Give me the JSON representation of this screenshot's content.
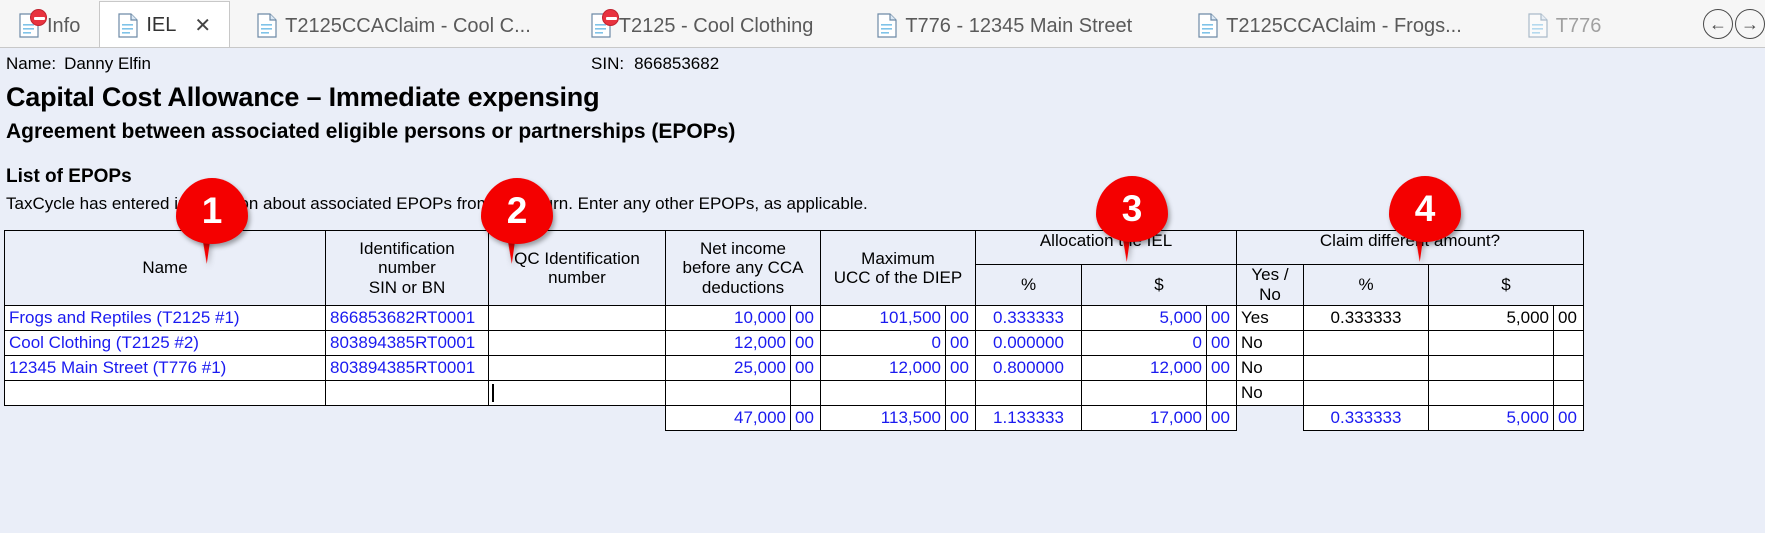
{
  "tabs": [
    {
      "label": "Info",
      "icon": "document-error-icon",
      "active": false,
      "closable": false,
      "error": true
    },
    {
      "label": "IEL",
      "icon": "document-icon",
      "active": true,
      "closable": true,
      "error": false
    },
    {
      "label": "T2125CCAClaim - Cool C...",
      "icon": "document-icon",
      "active": false,
      "closable": false,
      "error": false
    },
    {
      "label": "T2125 - Cool Clothing",
      "icon": "document-error-icon",
      "active": false,
      "closable": false,
      "error": true
    },
    {
      "label": "T776 - 12345 Main Street",
      "icon": "document-icon",
      "active": false,
      "closable": false,
      "error": false
    },
    {
      "label": "T2125CCAClaim - Frogs...",
      "icon": "document-icon",
      "active": false,
      "closable": false,
      "error": false
    },
    {
      "label": "T776",
      "icon": "document-icon",
      "active": false,
      "closable": false,
      "error": false
    }
  ],
  "tab_close_glyph": "✕",
  "nav": {
    "back_icon": "arrow-left-circle-icon",
    "forward_icon": "arrow-right-circle-icon",
    "back_glyph": "←",
    "forward_glyph": "→"
  },
  "taxpayer": {
    "name_label": "Name:",
    "name_value": "Danny Elfin",
    "sin_label": "SIN:",
    "sin_value": "866853682"
  },
  "form": {
    "title": "Capital Cost Allowance – Immediate expensing",
    "subtitle": "Agreement between associated eligible persons or partnerships (EPOPs)",
    "section_heading": "List of EPOPs",
    "instruction": "TaxCycle has entered information about associated EPOPs from the return. Enter any other EPOPs, as applicable."
  },
  "table": {
    "headers": {
      "name": "Name",
      "identification_number": "Identification\nnumber\nSIN or BN",
      "identification_number_l1": "Identification",
      "identification_number_l2": "number",
      "identification_number_l3": "SIN or BN",
      "qc_identification_l1": "QC Identification",
      "qc_identification_l2": "number",
      "net_income_l1": "Net income",
      "net_income_l2": "before any CCA",
      "net_income_l3": "deductions",
      "max_ucc_l1": "Maximum",
      "max_ucc_l2": "UCC of the DIEP",
      "allocation_group": "Allocation the IEL",
      "claim_different_group": "Claim different amount?",
      "pct": "%",
      "dollar": "$",
      "yes_no": "Yes / No"
    },
    "rows": [
      {
        "name": "Frogs and Reptiles (T2125 #1)",
        "id_number": "866853682RT0001",
        "qc_id": "",
        "net_income": "10,000",
        "net_income_cents": "00",
        "max_ucc": "101,500",
        "max_ucc_cents": "00",
        "alloc_pct": "0.333333",
        "alloc_dollar": "5,000",
        "alloc_dollar_cents": "00",
        "yes_no": "Yes",
        "claim_pct": "0.333333",
        "claim_dollar": "5,000",
        "claim_dollar_cents": "00"
      },
      {
        "name": "Cool Clothing (T2125 #2)",
        "id_number": "803894385RT0001",
        "qc_id": "",
        "net_income": "12,000",
        "net_income_cents": "00",
        "max_ucc": "0",
        "max_ucc_cents": "00",
        "alloc_pct": "0.000000",
        "alloc_dollar": "0",
        "alloc_dollar_cents": "00",
        "yes_no": "No",
        "claim_pct": "",
        "claim_dollar": "",
        "claim_dollar_cents": ""
      },
      {
        "name": "12345 Main Street (T776 #1)",
        "id_number": "803894385RT0001",
        "qc_id": "",
        "net_income": "25,000",
        "net_income_cents": "00",
        "max_ucc": "12,000",
        "max_ucc_cents": "00",
        "alloc_pct": "0.800000",
        "alloc_dollar": "12,000",
        "alloc_dollar_cents": "00",
        "yes_no": "No",
        "claim_pct": "",
        "claim_dollar": "",
        "claim_dollar_cents": ""
      },
      {
        "name": "",
        "id_number": "",
        "qc_id": "",
        "net_income": "",
        "net_income_cents": "",
        "max_ucc": "",
        "max_ucc_cents": "",
        "alloc_pct": "",
        "alloc_dollar": "",
        "alloc_dollar_cents": "",
        "yes_no": "No",
        "claim_pct": "",
        "claim_dollar": "",
        "claim_dollar_cents": ""
      }
    ],
    "totals": {
      "net_income": "47,000",
      "net_income_cents": "00",
      "max_ucc": "113,500",
      "max_ucc_cents": "00",
      "alloc_pct": "1.133333",
      "alloc_dollar": "17,000",
      "alloc_dollar_cents": "00",
      "yes_no": "",
      "claim_pct": "0.333333",
      "claim_dollar": "5,000",
      "claim_dollar_cents": "00"
    }
  },
  "callouts": [
    {
      "number": "1"
    },
    {
      "number": "2"
    },
    {
      "number": "3"
    },
    {
      "number": "4"
    }
  ],
  "colors": {
    "form_background": "#eaeef8",
    "field_value": "#1a1af0",
    "callout_red": "#f40000",
    "tab_text": "#5a5a5a"
  }
}
